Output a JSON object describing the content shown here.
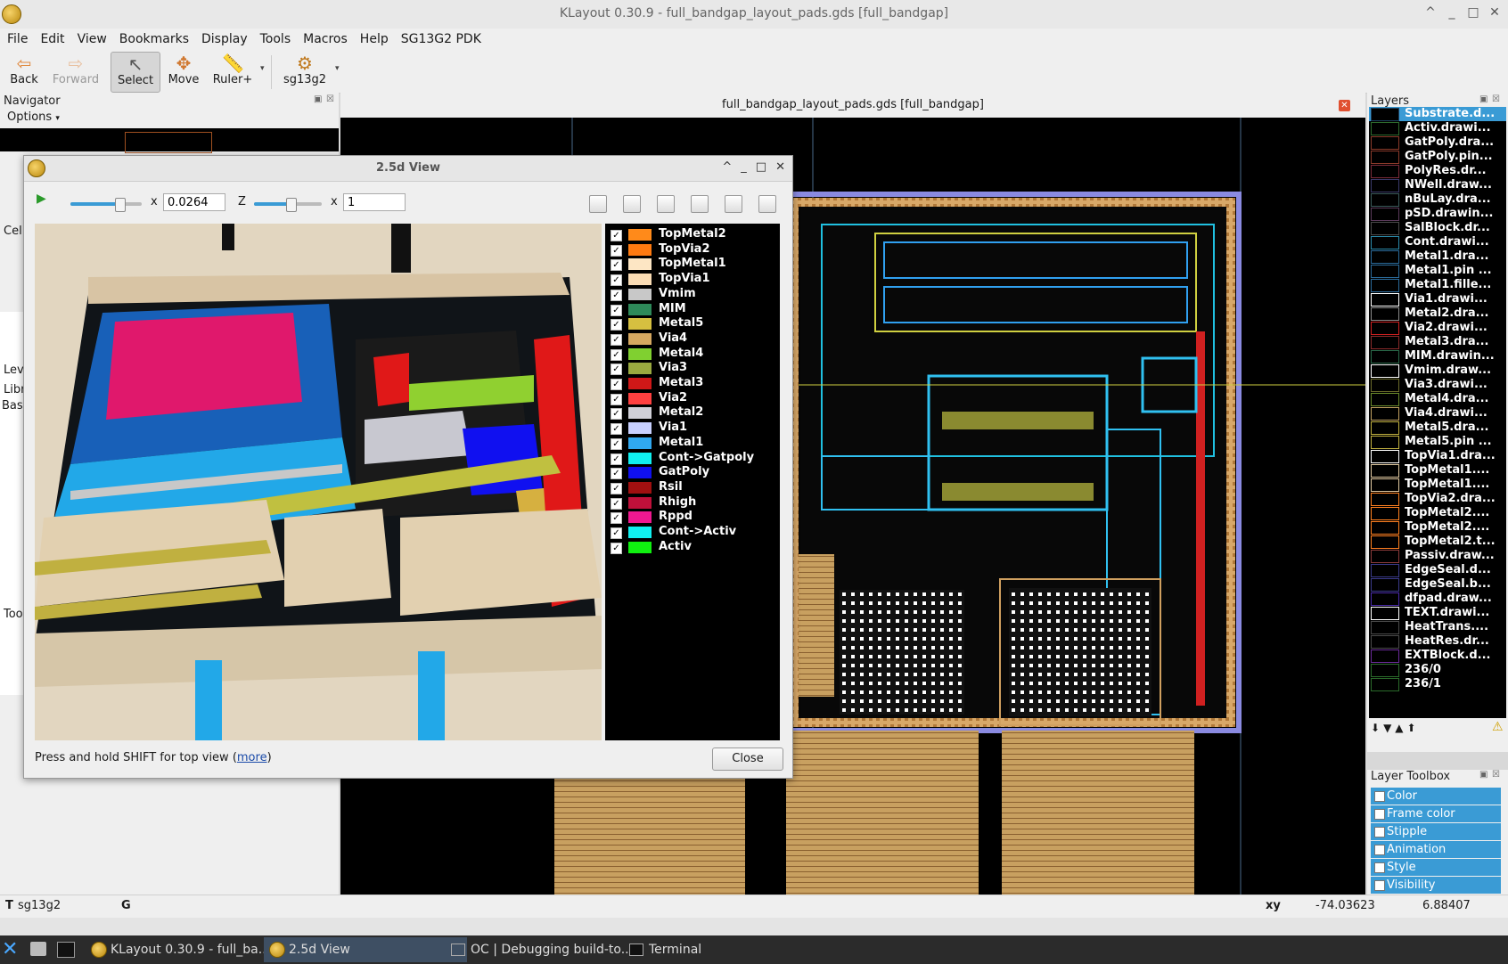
{
  "window": {
    "title": "KLayout 0.30.9 - full_bandgap_layout_pads.gds [full_bandgap]"
  },
  "menu": [
    "File",
    "Edit",
    "View",
    "Bookmarks",
    "Display",
    "Tools",
    "Macros",
    "Help",
    "SG13G2 PDK"
  ],
  "toolbar": {
    "back": "Back",
    "forward": "Forward",
    "select": "Select",
    "move": "Move",
    "ruler": "Ruler+",
    "pdk": "sg13g2"
  },
  "navigator": {
    "title": "Navigator",
    "options": "Options",
    "side_labels": [
      "Cel",
      "Lev",
      "Libr",
      "Bas",
      "Too"
    ]
  },
  "canvas": {
    "tab_title": "full_bandgap_layout_pads.gds [full_bandgap]"
  },
  "layers_panel": {
    "title": "Layers",
    "items": [
      {
        "name": "Substrate.d...",
        "color": "#1d3e5a"
      },
      {
        "name": "Activ.drawi...",
        "color": "#2d6a2d"
      },
      {
        "name": "GatPoly.dra...",
        "color": "#8a3a2a"
      },
      {
        "name": "GatPoly.pin...",
        "color": "#8a3a2a"
      },
      {
        "name": "PolyRes.dr...",
        "color": "#7a2a3a"
      },
      {
        "name": "NWell.draw...",
        "color": "#3a3a6a"
      },
      {
        "name": "nBuLay.dra...",
        "color": "#3a5a5a"
      },
      {
        "name": "pSD.drawin...",
        "color": "#5a3a5a"
      },
      {
        "name": "SalBlock.dr...",
        "color": "#4a4a4a"
      },
      {
        "name": "Cont.drawi...",
        "color": "#2a8aaa"
      },
      {
        "name": "Metal1.dra...",
        "color": "#2a6a9a"
      },
      {
        "name": "Metal1.pin ...",
        "color": "#2a6a9a"
      },
      {
        "name": "Metal1.fille...",
        "color": "#2a6a9a"
      },
      {
        "name": "Via1.drawi...",
        "color": "#ffffff"
      },
      {
        "name": "Metal2.dra...",
        "color": "#8a8a8a"
      },
      {
        "name": "Via2.drawi...",
        "color": "#d02020"
      },
      {
        "name": "Metal3.dra...",
        "color": "#8a2a2a"
      },
      {
        "name": "MIM.drawin...",
        "color": "#2a6a4a"
      },
      {
        "name": "Vmim.draw...",
        "color": "#ffffff"
      },
      {
        "name": "Via3.drawi...",
        "color": "#6a6a2a"
      },
      {
        "name": "Metal4.dra...",
        "color": "#6a8a2a"
      },
      {
        "name": "Via4.drawi...",
        "color": "#c0a060"
      },
      {
        "name": "Metal5.dra...",
        "color": "#c0b040"
      },
      {
        "name": "Metal5.pin ...",
        "color": "#c0b040"
      },
      {
        "name": "TopVia1.dra...",
        "color": "#ffffff"
      },
      {
        "name": "TopMetal1....",
        "color": "#e0c8a0"
      },
      {
        "name": "TopMetal1....",
        "color": "#e0c8a0"
      },
      {
        "name": "TopVia2.dra...",
        "color": "#ff8020"
      },
      {
        "name": "TopMetal2....",
        "color": "#ff8020"
      },
      {
        "name": "TopMetal2....",
        "color": "#ff8020"
      },
      {
        "name": "TopMetal2.t...",
        "color": "#ff8020"
      },
      {
        "name": "Passiv.draw...",
        "color": "#8a3a3a"
      },
      {
        "name": "EdgeSeal.d...",
        "color": "#3a3a8a"
      },
      {
        "name": "EdgeSeal.b...",
        "color": "#3a3a8a"
      },
      {
        "name": "dfpad.draw...",
        "color": "#4a2aaa"
      },
      {
        "name": "TEXT.drawi...",
        "color": "#ffffff"
      },
      {
        "name": "HeatTrans....",
        "color": "#4a4a4a"
      },
      {
        "name": "HeatRes.dr...",
        "color": "#4a4a4a"
      },
      {
        "name": "EXTBlock.d...",
        "color": "#6a2a9a"
      },
      {
        "name": "236/0",
        "color": "#2a6a2a"
      },
      {
        "name": "236/1",
        "color": "#2a6a2a"
      }
    ]
  },
  "layer_toolbox": {
    "title": "Layer Toolbox",
    "items": [
      "Color",
      "Frame color",
      "Stipple",
      "Animation",
      "Style",
      "Visibility"
    ]
  },
  "dialog": {
    "title": "2.5d View",
    "x_scale": "0.0264",
    "z_scale": "1",
    "x_label": "x",
    "z_label": "Z",
    "hint": "Press and hold SHIFT for top view (",
    "hint_link": "more",
    "hint_end": ")",
    "close": "Close",
    "legend": [
      {
        "name": "TopMetal2",
        "color": "#ff8a1a"
      },
      {
        "name": "TopVia2",
        "color": "#ff7a10"
      },
      {
        "name": "TopMetal1",
        "color": "#fde6c4"
      },
      {
        "name": "TopVia1",
        "color": "#fadcb4"
      },
      {
        "name": "Vmim",
        "color": "#c8c8c8"
      },
      {
        "name": "MIM",
        "color": "#2e8a5a"
      },
      {
        "name": "Metal5",
        "color": "#d6c040"
      },
      {
        "name": "Via4",
        "color": "#d6a860"
      },
      {
        "name": "Metal4",
        "color": "#80d030"
      },
      {
        "name": "Via3",
        "color": "#9aaa40"
      },
      {
        "name": "Metal3",
        "color": "#d01818"
      },
      {
        "name": "Via2",
        "color": "#ff4040"
      },
      {
        "name": "Metal2",
        "color": "#d0d0d8"
      },
      {
        "name": "Via1",
        "color": "#c8d0ff"
      },
      {
        "name": "Metal1",
        "color": "#30a8f0"
      },
      {
        "name": "Cont->Gatpoly",
        "color": "#10f0f0"
      },
      {
        "name": "GatPoly",
        "color": "#1010f0"
      },
      {
        "name": "Rsil",
        "color": "#a01010"
      },
      {
        "name": "Rhigh",
        "color": "#c0103a"
      },
      {
        "name": "Rppd",
        "color": "#f01890"
      },
      {
        "name": "Cont->Activ",
        "color": "#10f0f0"
      },
      {
        "name": "Activ",
        "color": "#10f010"
      }
    ]
  },
  "status": {
    "cell": "sg13g2",
    "g": "G",
    "xy_label": "xy",
    "x": "-74.03623",
    "y": "6.88407"
  },
  "taskbar": {
    "tasks": [
      "KLayout 0.30.9 - full_ba...",
      "2.5d View",
      "OC | Debugging build-to...",
      "Terminal"
    ]
  }
}
